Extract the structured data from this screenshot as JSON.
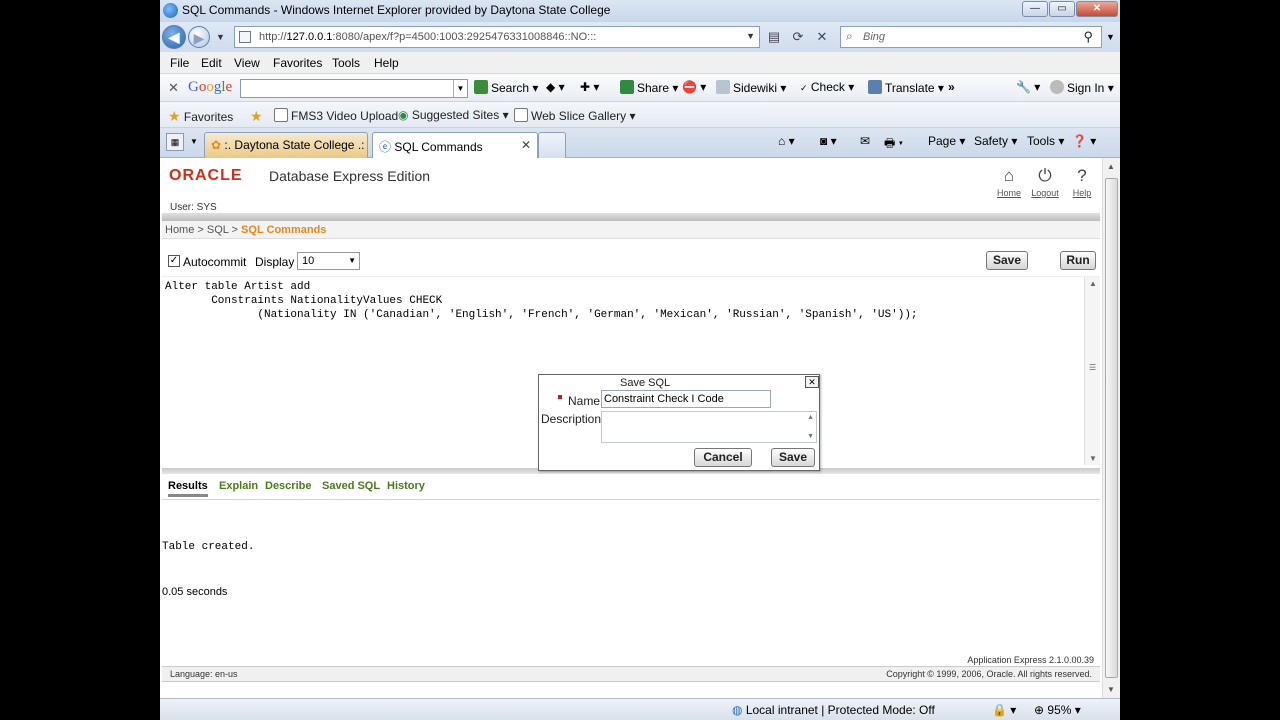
{
  "window": {
    "title": "SQL Commands - Windows Internet Explorer provided by Daytona State College",
    "min": "—",
    "max": "▭",
    "close": "✕"
  },
  "address": {
    "url_prefix": "http://",
    "url_host": "127.0.0.1",
    "url_rest": ":8080/apex/f?p=4500:1003:2925476331008846::NO:::",
    "search_placeholder": "Bing"
  },
  "menu": [
    "File",
    "Edit",
    "View",
    "Favorites",
    "Tools",
    "Help"
  ],
  "google_toolbar": {
    "logo": "Google",
    "search": "Search",
    "share": "Share",
    "sidewiki": "Sidewiki",
    "check": "Check",
    "translate": "Translate",
    "more": "»",
    "sign_in": "Sign In"
  },
  "favorites_bar": {
    "favorites": "Favorites",
    "items": [
      "FMS3 Video Upload",
      "Suggested Sites",
      "Web Slice Gallery"
    ]
  },
  "tabs": [
    {
      "label": ":. Daytona State College .:"
    },
    {
      "label": "SQL Commands"
    }
  ],
  "command_bar": {
    "page": "Page",
    "safety": "Safety",
    "tools": "Tools"
  },
  "apex": {
    "logo": "ORACLE",
    "product": "Database Express Edition",
    "home": "Home",
    "logout": "Logout",
    "help": "Help",
    "user": "User: SYS",
    "breadcrumb_home": "Home",
    "breadcrumb_sql": "SQL",
    "breadcrumb_current": "SQL Commands",
    "autocommit": "Autocommit",
    "display": "Display",
    "display_value": "10",
    "save": "Save",
    "run": "Run",
    "sql_text": "Alter table Artist add\n       Constraints NationalityValues CHECK\n              (Nationality IN ('Canadian', 'English', 'French', 'German', 'Mexican', 'Russian', 'Spanish', 'US'));",
    "result_tabs": [
      "Results",
      "Explain",
      "Describe",
      "Saved SQL",
      "History"
    ],
    "result_message": "Table created.",
    "elapsed": "0.05 seconds",
    "app_version": "Application Express 2.1.0.00.39",
    "language": "Language: en-us",
    "copyright": "Copyright © 1999, 2006, Oracle. All rights reserved."
  },
  "dialog": {
    "title": "Save SQL",
    "name_label": "Name",
    "name_value": "Constraint Check I Code",
    "description_label": "Description",
    "cancel": "Cancel",
    "save": "Save"
  },
  "status_bar": {
    "zone": "Local intranet | Protected Mode: Off",
    "zoom": "95%"
  }
}
